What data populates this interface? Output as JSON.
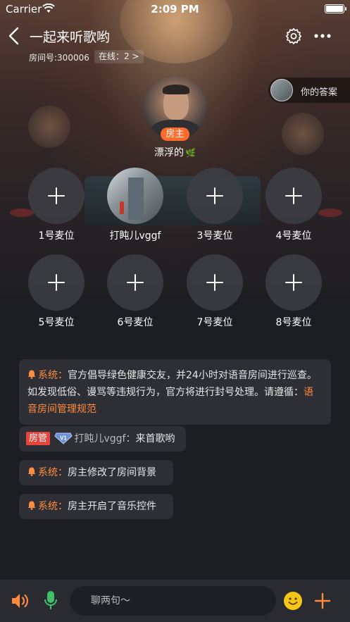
{
  "status_bar": {
    "carrier": "Carrier",
    "time": "2:09 PM"
  },
  "header": {
    "title": "一起来听歌哟",
    "room_id": "房间号:300006",
    "online": "在线：2 >"
  },
  "answer_chip": {
    "label": "你的答案"
  },
  "host": {
    "badge": "房主",
    "name": "漂浮的",
    "name_emoji": "🌿"
  },
  "seats": [
    {
      "label": "1号麦位",
      "occupied": false
    },
    {
      "label": "打盹儿vggf",
      "occupied": true
    },
    {
      "label": "3号麦位",
      "occupied": false
    },
    {
      "label": "4号麦位",
      "occupied": false
    },
    {
      "label": "5号麦位",
      "occupied": false
    },
    {
      "label": "6号麦位",
      "occupied": false
    },
    {
      "label": "7号麦位",
      "occupied": false
    },
    {
      "label": "8号麦位",
      "occupied": false
    }
  ],
  "messages": {
    "notice": {
      "prefix": "系统：",
      "text": "官方倡导绿色健康交友，并24小时对语音房间进行巡查。如发现低俗、谩骂等违规行为，官方将进行封号处理。请遵循：",
      "link": "语音房间管理规范"
    },
    "user_msg": {
      "role": "房管",
      "level": "V1",
      "user": "打盹儿vggf：",
      "text": "来首歌哟"
    },
    "sys1": {
      "prefix": "系统：",
      "text": "房主修改了房间背景"
    },
    "sys2": {
      "prefix": "系统：",
      "text": "房主开启了音乐控件"
    }
  },
  "bottom_bar": {
    "input_placeholder": "聊两句～"
  },
  "colors": {
    "accent": "#ff8a3d",
    "host_badge": "#ff6b2c",
    "role_tag": "#e7443c",
    "mic_green": "#3ec06b",
    "emoji_yellow": "#f5c518"
  }
}
